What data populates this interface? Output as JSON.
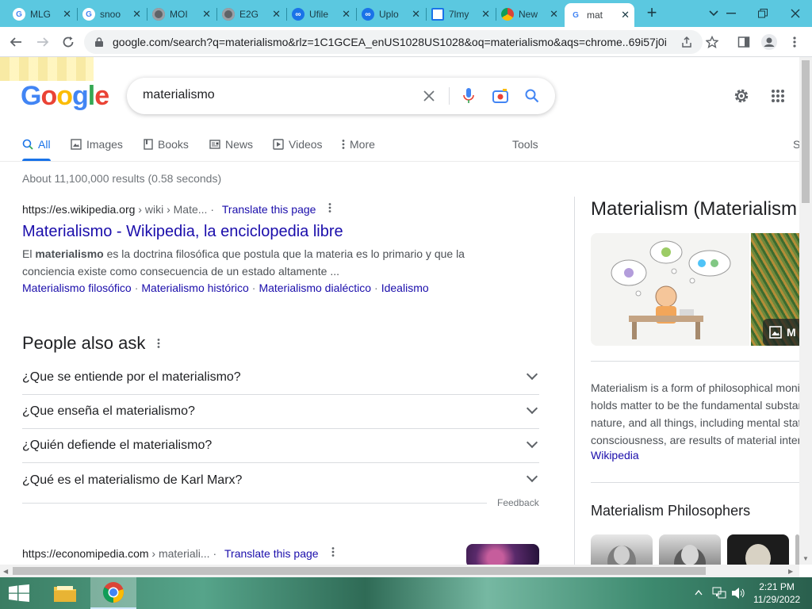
{
  "browser": {
    "tabs": [
      {
        "title": "MLG",
        "icon": "google-g-icon",
        "color": "#4285f4"
      },
      {
        "title": "snoo",
        "icon": "google-g-icon",
        "color": "#4285f4"
      },
      {
        "title": "MOI",
        "icon": "globe-icon",
        "color": "#5f6368"
      },
      {
        "title": "E2G",
        "icon": "globe-icon",
        "color": "#5f6368"
      },
      {
        "title": "Ufile",
        "icon": "cloud-icon",
        "color": "#1a73e8"
      },
      {
        "title": "Uplo",
        "icon": "cloud-icon",
        "color": "#1a73e8"
      },
      {
        "title": "7lmy",
        "icon": "doc-icon",
        "color": "#1a73e8"
      },
      {
        "title": "New",
        "icon": "chrome-icon",
        "color": "#5f6368"
      },
      {
        "title": "mat",
        "icon": "google-g-icon",
        "color": "#4285f4"
      }
    ],
    "active_tab": 8,
    "url": "google.com/search?q=materialismo&rlz=1C1GCEA_enUS1028US1028&oq=materialismo&aqs=chrome..69i57j0i..."
  },
  "search": {
    "logo": "Google",
    "query": "materialismo",
    "tabs": [
      "All",
      "Images",
      "Books",
      "News",
      "Videos",
      "More"
    ],
    "tools_label": "Tools",
    "safe_label": "S",
    "stats": "About 11,100,000 results (0.58 seconds)"
  },
  "result1": {
    "site": "https://es.wikipedia.org",
    "path": " › wiki › Mate...",
    "translate": "Translate this page",
    "title": "Materialismo - Wikipedia, la enciclopedia libre",
    "snippet_pre": "El ",
    "snippet_bold": "materialismo",
    "snippet_post": " es la doctrina filosófica que postula que la materia es lo primario y que la conciencia existe como consecuencia de un estado altamente ...",
    "sitelinks": [
      "Materialismo filosófico",
      "Materialismo histórico",
      "Materialismo dialéctico",
      "Idealismo"
    ]
  },
  "paa": {
    "title": "People also ask",
    "questions": [
      "¿Que se entiende por el materialismo?",
      "¿Que enseña el materialismo?",
      "¿Quién defiende el materialismo?",
      "¿Qué es el materialismo de Karl Marx?"
    ],
    "feedback": "Feedback"
  },
  "result2": {
    "site": "https://economipedia.com",
    "path": " › materiali...",
    "translate": "Translate this page"
  },
  "knowledge_panel": {
    "title": "Materialism (Materialism",
    "more_label": "M",
    "desc_lines": [
      "Materialism is a form of philosophical monism that",
      "holds matter to be the fundamental substance in",
      "nature, and all things, including mental states and",
      "consciousness, are results of material interactions."
    ],
    "source": "Wikipedia",
    "philosophers_title": "Materialism Philosophers"
  },
  "taskbar": {
    "time": "2:21 PM",
    "date": "11/29/2022"
  }
}
